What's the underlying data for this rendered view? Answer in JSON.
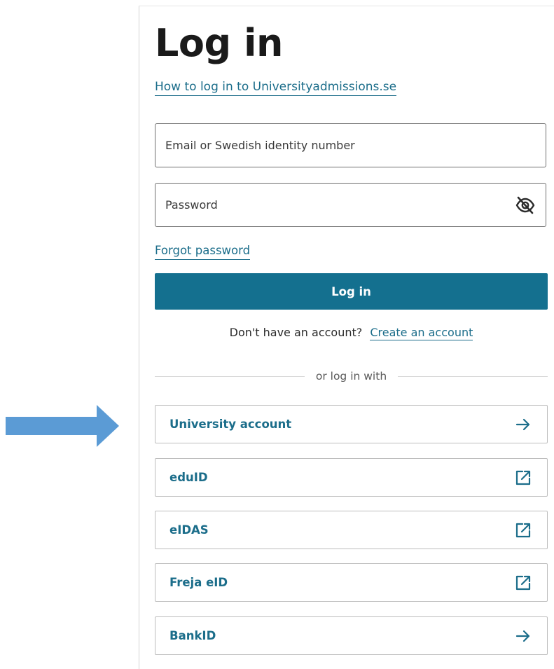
{
  "login": {
    "title": "Log in",
    "how_to_link": "How to log in to Universityadmissions.se",
    "email_placeholder": "Email or Swedish identity number",
    "password_placeholder": "Password",
    "forgot_password_link": "Forgot password",
    "login_button": "Log in",
    "no_account_text": "Don't have an account?",
    "create_account_link": "Create an account",
    "divider_text": "or log in with"
  },
  "providers": [
    {
      "label": "University account",
      "icon": "arrow-right-icon"
    },
    {
      "label": "eduID",
      "icon": "external-link-icon"
    },
    {
      "label": "eIDAS",
      "icon": "external-link-icon"
    },
    {
      "label": "Freja eID",
      "icon": "external-link-icon"
    },
    {
      "label": "BankID",
      "icon": "arrow-right-icon"
    }
  ],
  "colors": {
    "primary": "#14708f",
    "link": "#1b6d8a",
    "callout_arrow": "#5b9bd5"
  }
}
